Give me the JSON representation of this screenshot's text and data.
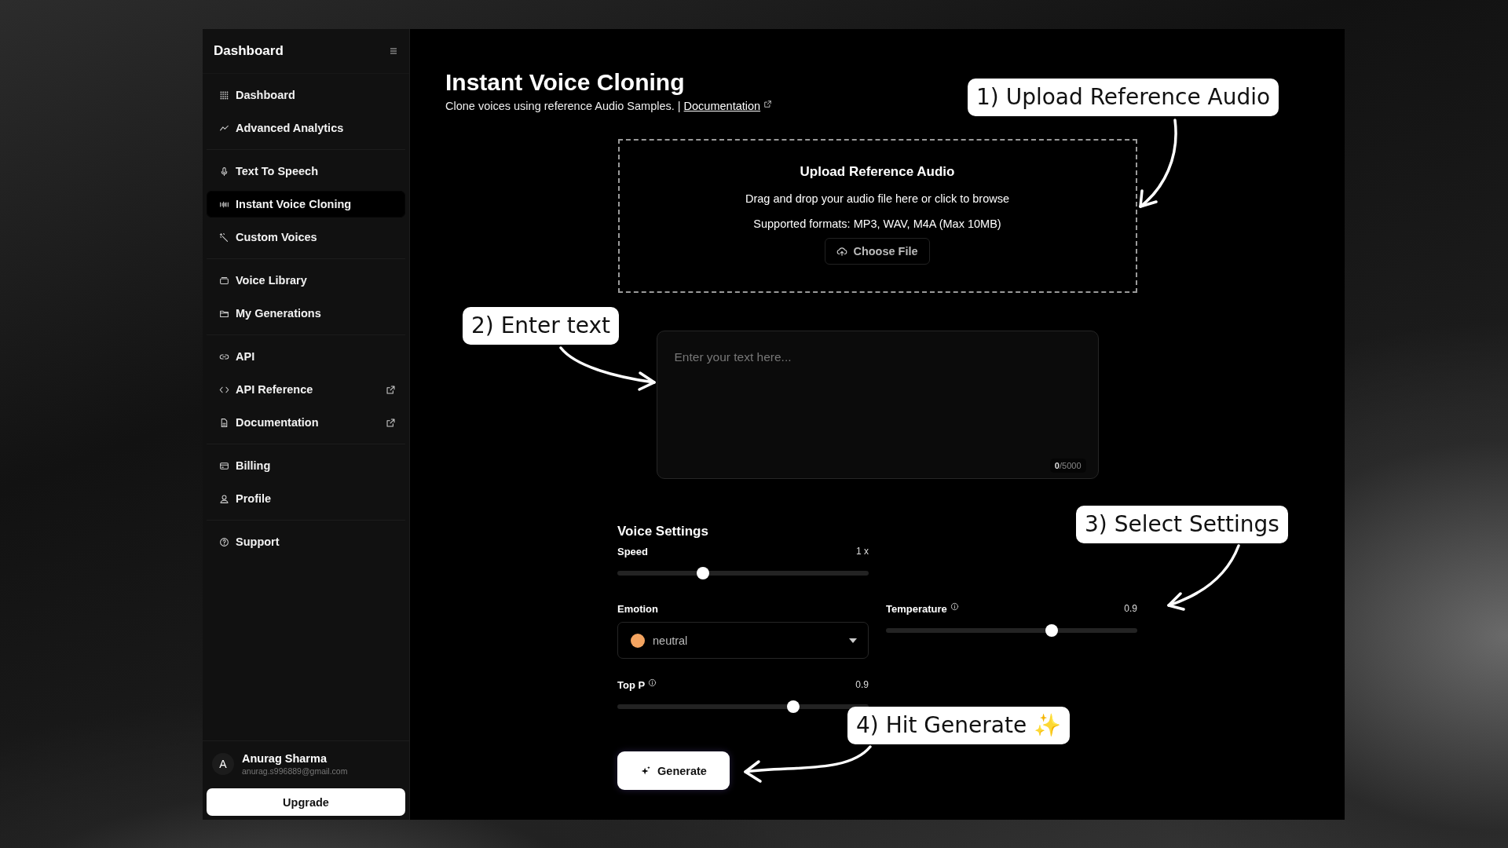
{
  "sidebar": {
    "title": "Dashboard",
    "groups": [
      {
        "items": [
          {
            "label": "Dashboard",
            "selected": false,
            "external": false
          },
          {
            "label": "Advanced Analytics",
            "selected": false,
            "external": false
          }
        ]
      },
      {
        "items": [
          {
            "label": "Text To Speech",
            "selected": false,
            "external": false
          },
          {
            "label": "Instant Voice Cloning",
            "selected": true,
            "external": false
          },
          {
            "label": "Custom Voices",
            "selected": false,
            "external": false
          }
        ]
      },
      {
        "items": [
          {
            "label": "Voice Library",
            "selected": false,
            "external": false
          },
          {
            "label": "My Generations",
            "selected": false,
            "external": false
          }
        ]
      },
      {
        "items": [
          {
            "label": "API",
            "selected": false,
            "external": false
          },
          {
            "label": "API Reference",
            "selected": false,
            "external": true
          },
          {
            "label": "Documentation",
            "selected": false,
            "external": true
          }
        ]
      },
      {
        "items": [
          {
            "label": "Billing",
            "selected": false,
            "external": false
          },
          {
            "label": "Profile",
            "selected": false,
            "external": false
          }
        ]
      },
      {
        "items": [
          {
            "label": "Support",
            "selected": false,
            "external": false
          }
        ]
      }
    ],
    "user": {
      "initial": "A",
      "name": "Anurag Sharma",
      "email": "anurag.s996889@gmail.com"
    },
    "upgrade_button": "Upgrade"
  },
  "page": {
    "title": "Instant Voice Cloning",
    "subtitle": "Clone voices using reference Audio Samples. |",
    "doc_link": "Documentation"
  },
  "upload": {
    "title": "Upload Reference Audio",
    "hint": "Drag and drop your audio file here or click to browse",
    "formats": "Supported formats: MP3, WAV, M4A (Max 10MB)",
    "button": "Choose File"
  },
  "text_input": {
    "placeholder": "Enter your text here...",
    "counter": "**0**/5000"
  },
  "voice_settings": {
    "title": "Voice Settings",
    "speed": {
      "label": "Speed",
      "reading": "1 x",
      "level": 0.34,
      "info": false
    },
    "emotion": {
      "label": "Emotion",
      "value": "neutral"
    },
    "temperature": {
      "label": "Temperature",
      "reading": "0.9",
      "level": 0.66,
      "info": true
    },
    "top_p": {
      "label": "Top P",
      "reading": "0.9",
      "level": 0.7,
      "info": true
    }
  },
  "generate_button": "Generate",
  "annotations": [
    {
      "text": "1) Upload Reference Audio"
    },
    {
      "text": "2) Enter text"
    },
    {
      "text": "3) Select Settings"
    },
    {
      "text": "4) Hit Generate ✨"
    }
  ]
}
